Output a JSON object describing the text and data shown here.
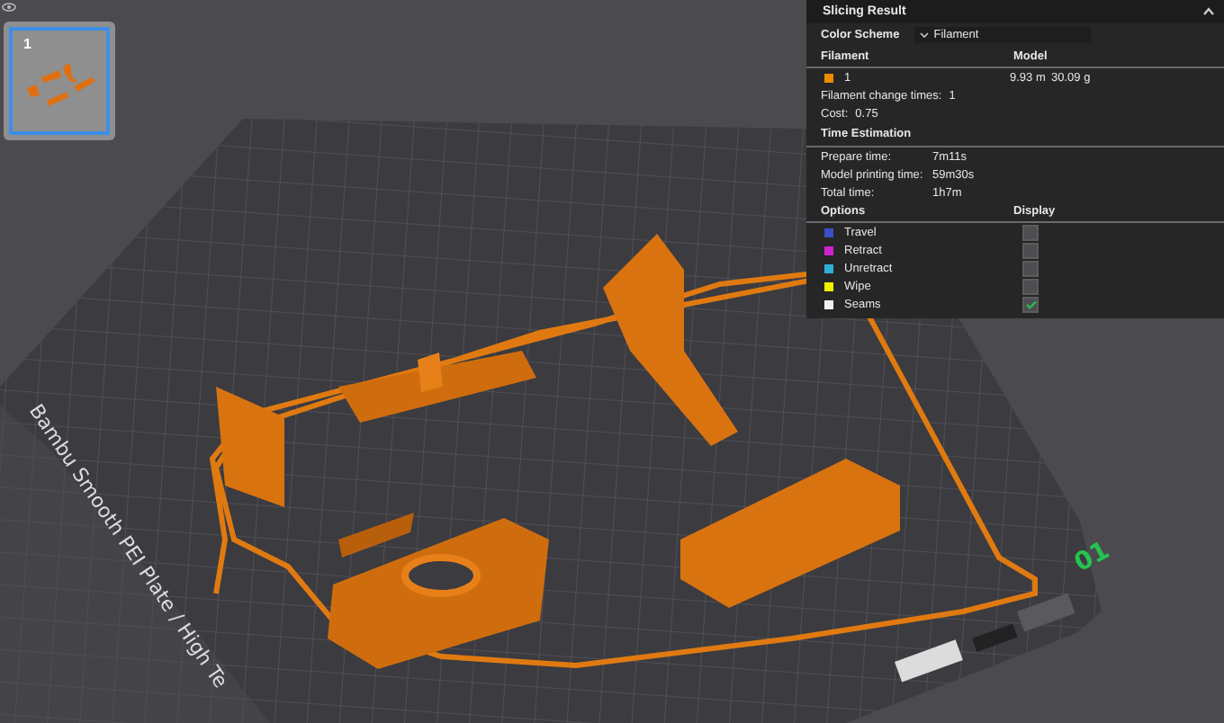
{
  "viewport": {
    "plate_label": "Bambu Smooth PEI Plate / High Te",
    "plate_number": "01",
    "thumbnail": {
      "label": "1",
      "selected": true
    }
  },
  "panel": {
    "title": "Slicing Result",
    "color_scheme": {
      "label": "Color Scheme",
      "value": "Filament"
    },
    "filament": {
      "columns": [
        "Filament",
        "Model"
      ],
      "rows": [
        {
          "name": "1",
          "color": "#f08c00",
          "length": "9.93 m",
          "weight": "30.09 g"
        }
      ],
      "stats": [
        {
          "label": "Filament change times:",
          "value": "1"
        },
        {
          "label": "Cost:",
          "value": "0.75"
        }
      ]
    },
    "time": {
      "title": "Time Estimation",
      "rows": [
        {
          "label": "Prepare time:",
          "value": "7m11s"
        },
        {
          "label": "Model printing time:",
          "value": "59m30s"
        },
        {
          "label": "Total time:",
          "value": "1h7m"
        }
      ]
    },
    "options": {
      "columns": [
        "Options",
        "Display"
      ],
      "rows": [
        {
          "name": "Travel",
          "color": "#3a4fc8",
          "checked": false
        },
        {
          "name": "Retract",
          "color": "#d020d0",
          "checked": false
        },
        {
          "name": "Unretract",
          "color": "#30b0d8",
          "checked": false
        },
        {
          "name": "Wipe",
          "color": "#f0f000",
          "checked": false
        },
        {
          "name": "Seams",
          "color": "#f0f0f0",
          "checked": true
        }
      ]
    }
  }
}
